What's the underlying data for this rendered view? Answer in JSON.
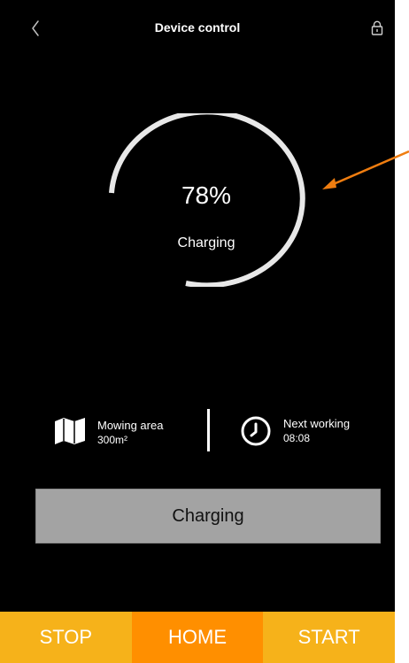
{
  "header": {
    "title": "Device control",
    "back_icon": "chevron-left-icon",
    "lock_icon": "lock-icon"
  },
  "battery": {
    "percent_text": "78%",
    "percent_value": 78,
    "status": "Charging"
  },
  "info": {
    "area": {
      "label": "Mowing area",
      "value": "300m²",
      "icon": "map-icon"
    },
    "next": {
      "label": "Next working",
      "value": "08:08",
      "icon": "clock-icon"
    }
  },
  "action_button": {
    "label": "Charging"
  },
  "bottom_nav": {
    "stop": "STOP",
    "home": "HOME",
    "start": "START"
  },
  "colors": {
    "background": "#000000",
    "ring": "#e8e8e8",
    "button_gray": "#a3a3a3",
    "nav_yellow": "#f6b21a",
    "nav_orange": "#ff8f00",
    "annotation": "#ef7d10"
  }
}
